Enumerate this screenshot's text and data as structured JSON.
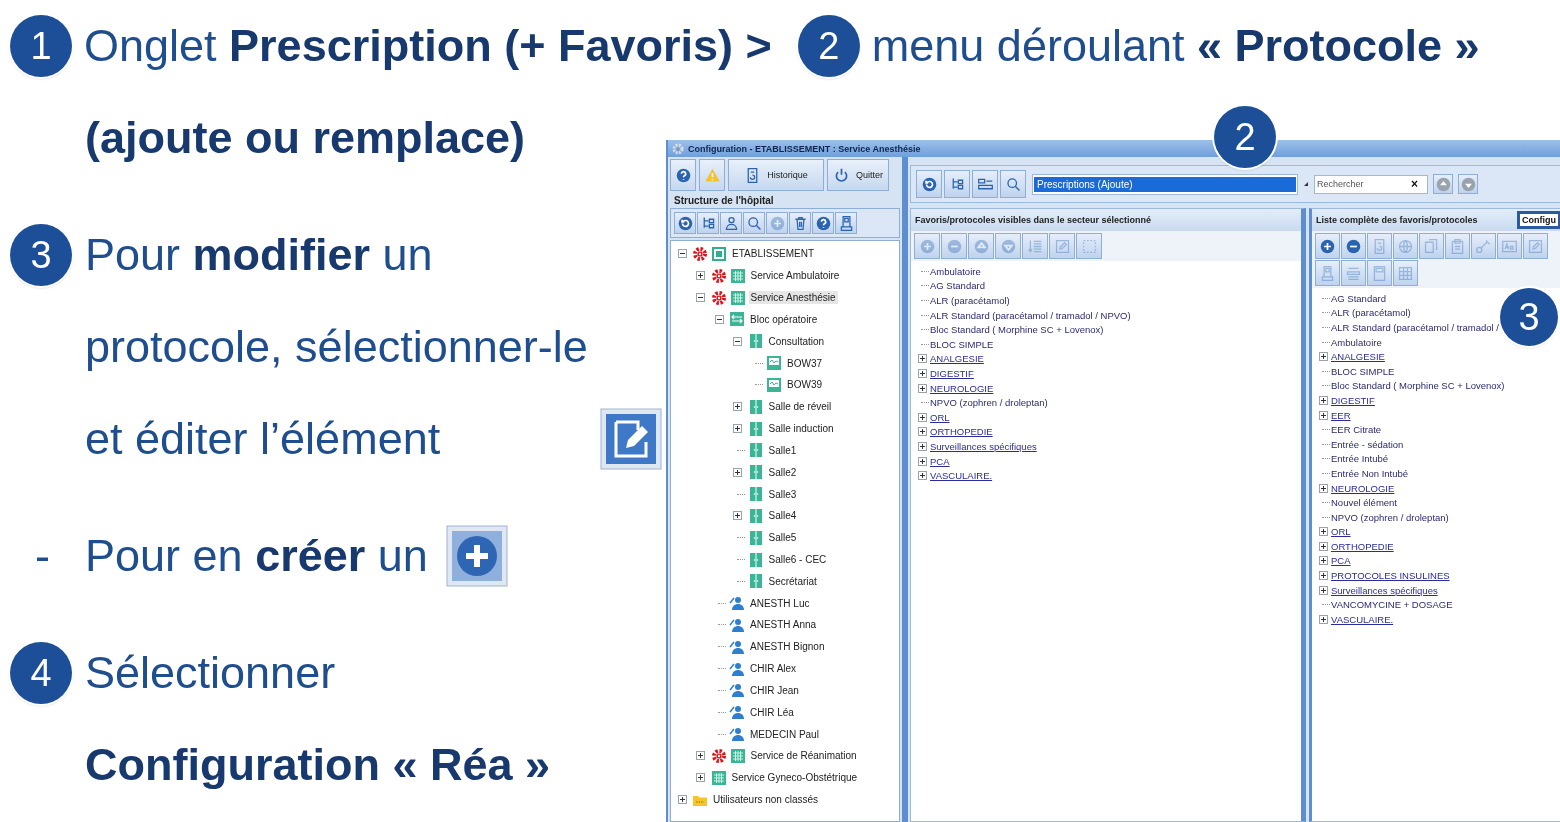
{
  "slide": {
    "step_1": {
      "number": "1",
      "text": "Onglet **Prescription (+ Favoris) >**"
    },
    "step_2": {
      "number": "2",
      "text": "menu déroulant **« Protocole »**"
    },
    "step_2_note": "(ajoute ou remplace)",
    "step_3": {
      "number": "3",
      "lines": [
        "Pour **modifier** un",
        "protocole, sélectionner-le",
        "et éditer l’élément"
      ]
    },
    "bullet": {
      "marker": "-",
      "text": "Pour en **créer** un"
    },
    "step_4": {
      "number": "4",
      "lines": [
        "Sélectionner",
        "**Configuration « Réa »**"
      ]
    }
  },
  "callouts": [
    {
      "number": "2"
    },
    {
      "number": "3"
    }
  ],
  "window": {
    "title": "Configuration - ETABLISSEMENT : Service Anesthésie",
    "buttons": [
      "Historique",
      "Quitter"
    ]
  },
  "structure": {
    "title": "Structure de l'hôpital",
    "tools": [
      {
        "disabled": false
      },
      {
        "disabled": false
      },
      {
        "disabled": false
      },
      {
        "disabled": false
      },
      {
        "disabled": true
      },
      {
        "disabled": false
      },
      {
        "disabled": false
      },
      {
        "disabled": false
      }
    ],
    "tree": [
      {
        "label": "ETABLISSEMENT",
        "kind": "establishment",
        "alert": true,
        "expanded": true,
        "selected": false,
        "children": [
          {
            "label": "Service Ambulatoire",
            "kind": "service",
            "alert": true,
            "expanded": false,
            "selected": false
          },
          {
            "label": "Service Anesthésie",
            "kind": "service",
            "alert": true,
            "expanded": true,
            "selected": true,
            "children": [
              {
                "label": "Bloc opératoire",
                "kind": "bloc",
                "alert": false,
                "expanded": true,
                "selected": false,
                "children": [
                  {
                    "label": "Consultation",
                    "kind": "room",
                    "alert": false,
                    "expanded": true,
                    "selected": false,
                    "children": [
                      {
                        "label": "BOW37",
                        "kind": "device",
                        "alert": false,
                        "selected": false
                      },
                      {
                        "label": "BOW39",
                        "kind": "device",
                        "alert": false,
                        "selected": false
                      }
                    ]
                  },
                  {
                    "label": "Salle de réveil",
                    "kind": "room",
                    "alert": false,
                    "expanded": false,
                    "selected": false
                  },
                  {
                    "label": "Salle induction",
                    "kind": "room",
                    "alert": false,
                    "expanded": false,
                    "selected": false
                  },
                  {
                    "label": "Salle1",
                    "kind": "room",
                    "alert": false,
                    "selected": false
                  },
                  {
                    "label": "Salle2",
                    "kind": "room",
                    "alert": false,
                    "expanded": false,
                    "selected": false
                  },
                  {
                    "label": "Salle3",
                    "kind": "room",
                    "alert": false,
                    "selected": false
                  },
                  {
                    "label": "Salle4",
                    "kind": "room",
                    "alert": false,
                    "expanded": false,
                    "selected": false
                  },
                  {
                    "label": "Salle5",
                    "kind": "room",
                    "alert": false,
                    "selected": false
                  },
                  {
                    "label": "Salle6 - CEC",
                    "kind": "room",
                    "alert": false,
                    "selected": false
                  },
                  {
                    "label": "Secrétariat",
                    "kind": "room",
                    "alert": false,
                    "selected": false
                  }
                ]
              },
              {
                "label": "ANESTH Luc",
                "kind": "user",
                "alert": false,
                "selected": false
              },
              {
                "label": "ANESTH Anna",
                "kind": "user",
                "alert": false,
                "selected": false
              },
              {
                "label": "ANESTH Bignon",
                "kind": "user",
                "alert": false,
                "selected": false
              },
              {
                "label": "CHIR Alex",
                "kind": "user",
                "alert": false,
                "selected": false
              },
              {
                "label": "CHIR Jean",
                "kind": "user",
                "alert": false,
                "selected": false
              },
              {
                "label": "CHIR Léa",
                "kind": "user",
                "alert": false,
                "selected": false
              },
              {
                "label": "MEDECIN Paul",
                "kind": "user",
                "alert": false,
                "selected": false
              }
            ]
          },
          {
            "label": "Service de Réanimation",
            "kind": "service",
            "alert": true,
            "expanded": false,
            "selected": false
          },
          {
            "label": "Service Gyneco-Obstétrique",
            "kind": "service",
            "alert": false,
            "expanded": false,
            "selected": false
          }
        ]
      },
      {
        "label": "Utilisateurs non classés",
        "kind": "folder",
        "alert": false,
        "expanded": false,
        "selected": false
      }
    ]
  },
  "prescription_toolbar": {
    "protocol_dropdown": "Prescriptions (Ajoute)",
    "search": {
      "placeholder": "Rechercher",
      "clear_button": "×"
    }
  },
  "visible_panel": {
    "title": "Favoris/protocoles visibles dans le secteur sélectionné",
    "tools": [
      {
        "disabled": true
      },
      {
        "disabled": true
      },
      {
        "disabled": true
      },
      {
        "disabled": true
      },
      {
        "disabled": true
      },
      {
        "disabled": true
      },
      {
        "disabled": true
      }
    ],
    "items": [
      {
        "label": "Ambulatoire",
        "kind": "item"
      },
      {
        "label": "AG Standard",
        "kind": "item"
      },
      {
        "label": "ALR (paracétamol)",
        "kind": "item"
      },
      {
        "label": "ALR Standard (paracétamol / tramadol / NPVO)",
        "kind": "item"
      },
      {
        "label": "Bloc Standard ( Morphine SC + Lovenox)",
        "kind": "item"
      },
      {
        "label": "BLOC SIMPLE",
        "kind": "item"
      },
      {
        "label": "ANALGESIE",
        "kind": "group",
        "expanded": false
      },
      {
        "label": "DIGESTIF",
        "kind": "group",
        "expanded": false
      },
      {
        "label": "NEUROLOGIE",
        "kind": "group",
        "expanded": false
      },
      {
        "label": "NPVO (zophren / droleptan)",
        "kind": "item"
      },
      {
        "label": "ORL",
        "kind": "group",
        "expanded": false
      },
      {
        "label": "ORTHOPEDIE",
        "kind": "group",
        "expanded": false
      },
      {
        "label": "Surveillances spécifiques",
        "kind": "group",
        "expanded": false
      },
      {
        "label": "PCA",
        "kind": "group",
        "expanded": false
      },
      {
        "label": "VASCULAIRE.",
        "kind": "group",
        "expanded": false
      }
    ]
  },
  "complete_panel": {
    "title": "Liste complète des favoris/protocoles",
    "dropdown": "Configu",
    "tools": [
      {
        "disabled": false
      },
      {
        "disabled": false
      },
      {
        "disabled": true
      },
      {
        "disabled": true
      },
      {
        "disabled": true
      },
      {
        "disabled": true
      },
      {
        "disabled": true
      },
      {
        "disabled": true
      },
      {
        "disabled": true
      },
      {
        "disabled": true
      },
      {
        "disabled": true
      },
      {
        "disabled": true
      },
      {
        "disabled": true
      }
    ],
    "items": [
      {
        "label": "AG Standard",
        "kind": "item"
      },
      {
        "label": "ALR (paracétamol)",
        "kind": "item"
      },
      {
        "label": "ALR Standard (paracétamol / tramadol /",
        "kind": "item"
      },
      {
        "label": "Ambulatoire",
        "kind": "item"
      },
      {
        "label": "ANALGESIE",
        "kind": "group",
        "expanded": false
      },
      {
        "label": "BLOC SIMPLE",
        "kind": "item"
      },
      {
        "label": "Bloc Standard ( Morphine SC + Lovenox)",
        "kind": "item"
      },
      {
        "label": "DIGESTIF",
        "kind": "group",
        "expanded": false
      },
      {
        "label": "EER",
        "kind": "group",
        "expanded": false
      },
      {
        "label": "EER Citrate",
        "kind": "item"
      },
      {
        "label": "Entrée - sédation",
        "kind": "item"
      },
      {
        "label": "Entrée Intubé",
        "kind": "item"
      },
      {
        "label": "Entrée Non Intubé",
        "kind": "item"
      },
      {
        "label": "NEUROLOGIE",
        "kind": "group",
        "expanded": false
      },
      {
        "label": "Nouvel élément",
        "kind": "item"
      },
      {
        "label": "NPVO (zophren / droleptan)",
        "kind": "item"
      },
      {
        "label": "ORL",
        "kind": "group",
        "expanded": false
      },
      {
        "label": "ORTHOPEDIE",
        "kind": "group",
        "expanded": false
      },
      {
        "label": "PCA",
        "kind": "group",
        "expanded": false
      },
      {
        "label": "PROTOCOLES INSULINES",
        "kind": "group",
        "expanded": false
      },
      {
        "label": "Surveillances spécifiques",
        "kind": "group",
        "expanded": false
      },
      {
        "label": "VANCOMYCINE + DOSAGE",
        "kind": "item"
      },
      {
        "label": "VASCULAIRE.",
        "kind": "group",
        "expanded": false
      }
    ]
  }
}
